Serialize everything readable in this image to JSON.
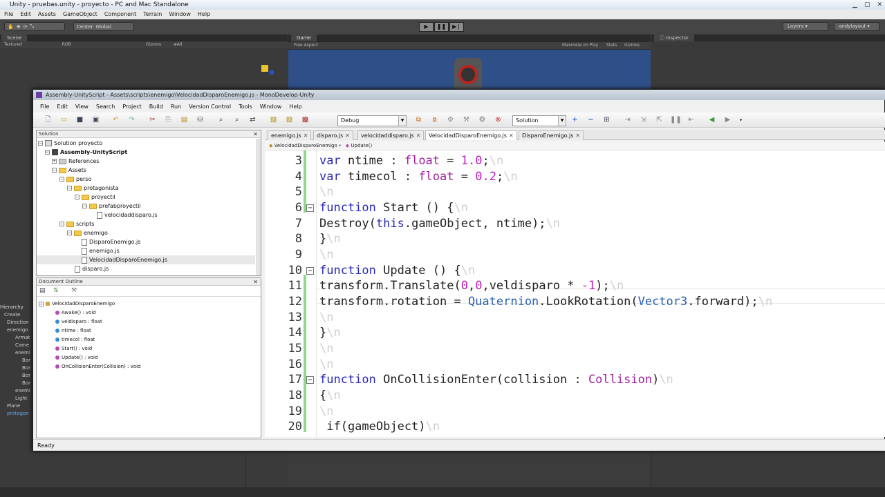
{
  "unity": {
    "title": "Unity - pruebas.unity - proyecto - PC and Mac Standalone",
    "menu": [
      "File",
      "Edit",
      "Assets",
      "GameObject",
      "Component",
      "Terrain",
      "Window",
      "Help"
    ],
    "pivot": "Center",
    "space": "Global",
    "layers": "Layers",
    "layout": "andylayout",
    "scene_tab": "Scene",
    "scene_textured": "Textured",
    "scene_rgb": "RGB",
    "scene_gizmos": "Gizmos",
    "scene_search": "⊕All",
    "game_tab": "Game",
    "game_aspect": "Free Aspect",
    "game_maximize": "Maximize on Play",
    "game_stats": "Stats",
    "game_gizmos": "Gizmos",
    "inspector_tab": "Inspector",
    "hierarchy": {
      "title": "Hierarchy",
      "create": "Create",
      "items": [
        "Direction",
        "enemigo",
        "Armat",
        "Came",
        "enemi",
        "Bor",
        "Bor",
        "Bor",
        "Bor",
        "enemi",
        "Light",
        "Plane",
        "protagon"
      ]
    }
  },
  "md": {
    "title": "Assembly-UnityScript - Assets\\scripts\\enemigo\\VelocidadDisparoEnemigo.js - MonoDevelop-Unity",
    "menu": [
      "File",
      "Edit",
      "View",
      "Search",
      "Project",
      "Build",
      "Run",
      "Version Control",
      "Tools",
      "Window",
      "Help"
    ],
    "config": "Debug",
    "scope": "Solution",
    "solution_pad": {
      "title": "Solution",
      "rows": [
        {
          "label": "Solution proyecto",
          "icon": "solution"
        },
        {
          "label": "Assembly-UnityScript",
          "icon": "project"
        },
        {
          "label": "References",
          "icon": "folder"
        },
        {
          "label": "Assets",
          "icon": "folder"
        },
        {
          "label": "perso",
          "icon": "folder"
        },
        {
          "label": "protagonista",
          "icon": "folder"
        },
        {
          "label": "proyectil",
          "icon": "folder"
        },
        {
          "label": "prefabproyectil",
          "icon": "folder"
        },
        {
          "label": "velocidaddisparo.js",
          "icon": "file"
        },
        {
          "label": "scripts",
          "icon": "folder"
        },
        {
          "label": "enemigo",
          "icon": "folder"
        },
        {
          "label": "DisparoEnemigo.js",
          "icon": "file"
        },
        {
          "label": "enemigo.js",
          "icon": "file"
        },
        {
          "label": "VelocidadDisparoEnemigo.js",
          "icon": "file"
        },
        {
          "label": "disparo.js",
          "icon": "file"
        }
      ]
    },
    "outline_pad": {
      "title": "Document Outline",
      "root": "VelocidadDisparoEnemigo",
      "items": [
        "Awake() : void",
        "veldisparo : float",
        "ntime : float",
        "timecol : float",
        "Start() : void",
        "Update() : void",
        "OnCollisionEnter(Collision) : void"
      ]
    },
    "tabs": [
      "enemigo.js",
      "disparo.js",
      "velocidaddisparo.js",
      "VelocidadDisparoEnemigo.js",
      "DisparoEnemigo.js"
    ],
    "active_tab": "VelocidadDisparoEnemigo.js",
    "path_class": "VelocidadDisparoEnemigo",
    "path_member": "Update()",
    "line_numbers": [
      "3",
      "4",
      "5",
      "6",
      "7",
      "8",
      "9",
      "10",
      "11",
      "12",
      "13",
      "14",
      "15",
      "16",
      "17",
      "18",
      "19",
      "20"
    ],
    "newline_marker": "\\n",
    "code": {
      "l3_kw": "var",
      "l3_a": " ntime : ",
      "l3_ty": "float",
      "l3_b": " = ",
      "l3_nu": "1.0",
      "l3_c": ";",
      "l4_kw": "var",
      "l4_a": " timecol : ",
      "l4_ty": "float",
      "l4_b": " = ",
      "l4_nu": "0.2",
      "l4_c": ";",
      "l6_kw": "function",
      "l6_a": " Start () {",
      "l7_a": "Destroy(",
      "l7_kw": "this",
      "l7_b": ".gameObject, ntime);",
      "l8_a": "}",
      "l10_kw": "function",
      "l10_a": " Update () {",
      "l11_a": "transform.Translate(",
      "l11_n1": "0",
      "l11_s1": ",",
      "l11_n2": "0",
      "l11_b": ",veldisparo * ",
      "l11_n3": "-1",
      "l11_c": ");",
      "l12_a": "transform.rotation = ",
      "l12_c1": "Quaternion",
      "l12_b": ".LookRotation(",
      "l12_c2": "Vector3",
      "l12_c": ".forward);",
      "l14_a": "}",
      "l17_kw": "function",
      "l17_a": " OnCollisionEnter(collision : ",
      "l17_ty": "Collision",
      "l17_b": ")",
      "l18_a": "{",
      "l20_a": " if(gameObject)"
    },
    "status": "Ready"
  }
}
